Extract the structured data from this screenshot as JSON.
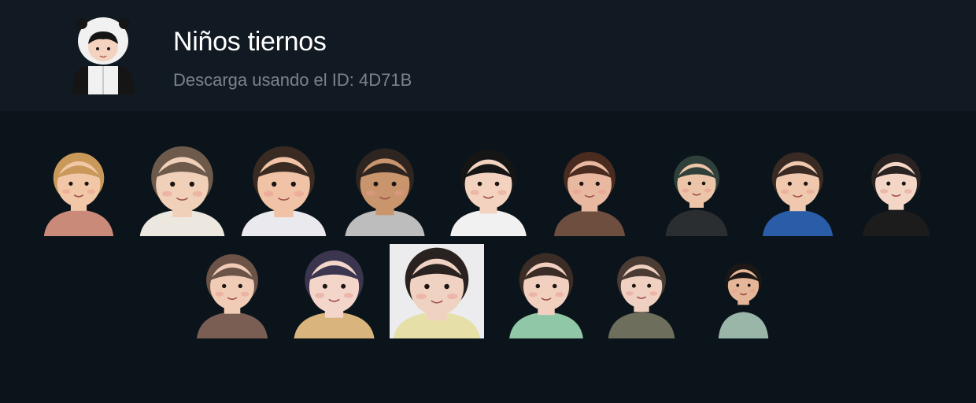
{
  "pack": {
    "title": "Niños tiernos",
    "download_text": "Descarga usando el ID: 4D71B"
  },
  "stickers": [
    {
      "name": "sticker-child-blonde-pink-shirt",
      "skin": "#f2c7a8",
      "hair": "#c9995a",
      "shirt": "#c98a7a"
    },
    {
      "name": "sticker-girl-white-sweater",
      "skin": "#f1d0ba",
      "hair": "#6d5a4a",
      "shirt": "#ece8df"
    },
    {
      "name": "sticker-baby-chubby-face",
      "skin": "#f0c3a6",
      "hair": "#3a2b22",
      "shirt": "#e9e9ee"
    },
    {
      "name": "sticker-toddler-round-face",
      "skin": "#c9956c",
      "hair": "#2e2420",
      "shirt": "#bdbdbd"
    },
    {
      "name": "sticker-child-panda-hood",
      "skin": "#f3d3c0",
      "hair": "#151515",
      "shirt": "#f1f1f1"
    },
    {
      "name": "sticker-child-brown-shirt",
      "skin": "#e8b9a0",
      "hair": "#4a2b20",
      "shirt": "#6e4e3f"
    },
    {
      "name": "sticker-boy-red-cap",
      "skin": "#ecc5a8",
      "hair": "#2f3f3a",
      "shirt": "#2b2e31"
    },
    {
      "name": "sticker-girl-hands-on-face",
      "skin": "#f0c8ad",
      "hair": "#3a2a24",
      "shirt": "#2a5da8"
    },
    {
      "name": "sticker-baby-hair-clip",
      "skin": "#f3d6c6",
      "hair": "#2a2322",
      "shirt": "#1c1c1c"
    },
    {
      "name": "sticker-child-heart-hands",
      "skin": "#f0ccb6",
      "hair": "#6b5347",
      "shirt": "#7a5e54"
    },
    {
      "name": "sticker-boy-teddy-bear",
      "skin": "#f3d6c9",
      "hair": "#3b3550",
      "shirt": "#d9b47d"
    },
    {
      "name": "sticker-baby-lying-pillow",
      "skin": "#f0d2c2",
      "hair": "#2a2220",
      "shirt": "#e6e0a8"
    },
    {
      "name": "sticker-baby-green-shirt",
      "skin": "#f1d0c0",
      "hair": "#3b2c26",
      "shirt": "#8fc7a7"
    },
    {
      "name": "sticker-girl-buns",
      "skin": "#f0d1c1",
      "hair": "#4a3b33",
      "shirt": "#6d6e5c"
    },
    {
      "name": "sticker-boy-smiling-tilted",
      "skin": "#e5b697",
      "hair": "#1a1716",
      "shirt": "#9ab6a8"
    }
  ]
}
